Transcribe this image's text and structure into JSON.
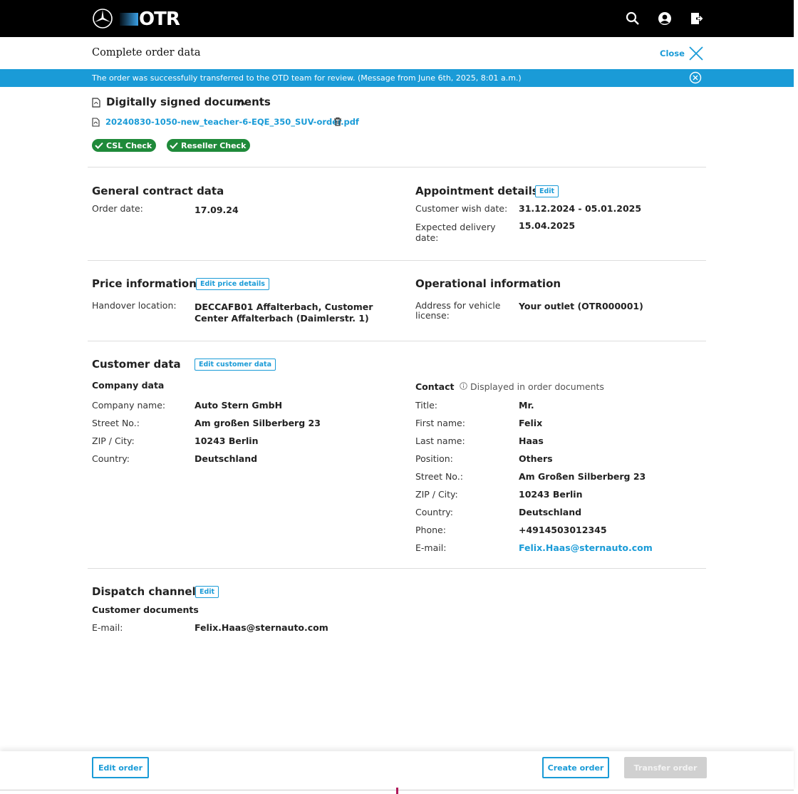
{
  "app": {
    "brand": "OTR"
  },
  "header": {
    "title": "Complete order data",
    "close_label": "Close"
  },
  "banner": {
    "message": "The order was successfully transferred to the OTD team for review.  (Message from June 6th, 2025, 8:01 a.m.)"
  },
  "documents": {
    "title": "Digitally signed documents",
    "file": "20240830-1050-new_teacher-6-EQE_350_SUV-order.pdf",
    "badges": [
      "CSL Check",
      "Reseller Check"
    ]
  },
  "general_contract": {
    "title": "General contract data",
    "order_date_label": "Order date:",
    "order_date": "17.09.24"
  },
  "appointment": {
    "title": "Appointment details",
    "edit_label": "Edit",
    "wish_label": "Customer wish date:",
    "wish_value": "31.12.2024 - 05.01.2025",
    "delivery_label_1": "Expected delivery",
    "delivery_label_2": "date:",
    "delivery_value": "15.04.2025"
  },
  "price": {
    "title": "Price information",
    "edit_label": "Edit price details",
    "handover_label": "Handover location:",
    "handover_line1": "DECCAFB01 Affalterbach, Customer",
    "handover_line2": "Center Affalterbach (Daimlerstr. 1)"
  },
  "operational": {
    "title": "Operational information",
    "address_label_1": "Address for vehicle",
    "address_label_2": "license:",
    "address_value": "Your outlet (OTR000001)"
  },
  "customer": {
    "title": "Customer data",
    "edit_label": "Edit customer data",
    "company_title": "Company data",
    "company_rows": [
      {
        "label": "Company name:",
        "value": "Auto Stern GmbH"
      },
      {
        "label": "Street No.:",
        "value": "Am großen Silberberg 23"
      },
      {
        "label": "ZIP / City:",
        "value": "10243 Berlin"
      },
      {
        "label": "Country:",
        "value": "Deutschland"
      }
    ],
    "contact_title": "Contact",
    "contact_note": "Displayed in order documents",
    "contact_rows": [
      {
        "label": "Title:",
        "value": "Mr."
      },
      {
        "label": "First name:",
        "value": "Felix"
      },
      {
        "label": "Last name:",
        "value": "Haas"
      },
      {
        "label": "Position:",
        "value": "Others"
      },
      {
        "label": "Street No.:",
        "value": "Am Großen Silberberg 23"
      },
      {
        "label": "ZIP / City:",
        "value": "10243 Berlin"
      },
      {
        "label": "Country:",
        "value": "Deutschland"
      },
      {
        "label": "Phone:",
        "value": "+4914503012345"
      },
      {
        "label": "E-mail:",
        "value": "Felix.Haas@sternauto.com"
      }
    ]
  },
  "dispatch": {
    "title": "Dispatch channel",
    "edit_label": "Edit",
    "sub_title": "Customer documents",
    "email_label": "E-mail:",
    "email_value": "Felix.Haas@sternauto.com"
  },
  "footer": {
    "edit_order": "Edit order",
    "create_order": "Create order",
    "transfer_order": "Transfer order"
  },
  "colors": {
    "accent": "#1a9bd7",
    "badge_green": "#1f8a3a",
    "topbar": "#000000"
  }
}
